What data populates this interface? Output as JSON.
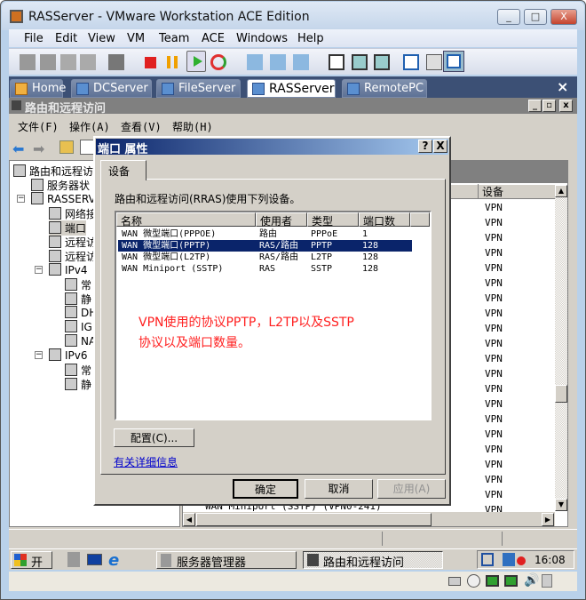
{
  "window": {
    "title": "RASServer - VMware Workstation ACE Edition",
    "min": "_",
    "max": "□",
    "close": "X"
  },
  "menu": [
    "File",
    "Edit",
    "View",
    "VM",
    "Team",
    "ACE",
    "Windows",
    "Help"
  ],
  "tabs": [
    {
      "label": "Home"
    },
    {
      "label": "DCServer"
    },
    {
      "label": "FileServer"
    },
    {
      "label": "RASServer",
      "active": true
    },
    {
      "label": "RemotePC"
    }
  ],
  "tabs_close": "×",
  "mmc": {
    "title": "路由和远程访问",
    "menu": [
      "文件(F)",
      "操作(A)",
      "查看(V)",
      "帮助(H)"
    ],
    "tree": [
      {
        "label": "路由和远程访",
        "level": 0
      },
      {
        "label": "服务器状",
        "level": 1
      },
      {
        "label": "RASSERVE",
        "level": 1,
        "expanded": true
      },
      {
        "label": "网络接",
        "level": 2
      },
      {
        "label": "端口",
        "level": 2
      },
      {
        "label": "远程访",
        "level": 2
      },
      {
        "label": "远程访",
        "level": 2
      },
      {
        "label": "IPv4",
        "level": 2,
        "expanded": true
      },
      {
        "label": "常",
        "level": 3
      },
      {
        "label": "静",
        "level": 3
      },
      {
        "label": "DH",
        "level": 3
      },
      {
        "label": "IG",
        "level": 3
      },
      {
        "label": "NA",
        "level": 3
      },
      {
        "label": "IPv6",
        "level": 2,
        "expanded": true
      },
      {
        "label": "常",
        "level": 3
      },
      {
        "label": "静",
        "level": 3
      }
    ],
    "right_column_header": "设备",
    "right_rows_value": "VPN",
    "right_row_count": 21,
    "right_last_row": "WAN Miniport (SSTP) (VPN0-241)"
  },
  "dialog": {
    "title": "端口 属性",
    "help": "?",
    "close": "X",
    "tab": "设备",
    "intro": "路由和远程访问(RRAS)使用下列设备。",
    "columns": [
      "名称",
      "使用者",
      "类型",
      "端口数"
    ],
    "rows": [
      [
        "WAN 微型端口(PPPOE)",
        "路由",
        "PPPoE",
        "1"
      ],
      [
        "WAN 微型端口(PPTP)",
        "RAS/路由",
        "PPTP",
        "128"
      ],
      [
        "WAN 微型端口(L2TP)",
        "RAS/路由",
        "L2TP",
        "128"
      ],
      [
        "WAN Miniport (SSTP)",
        "RAS",
        "SSTP",
        "128"
      ]
    ],
    "selected_row": 1,
    "annotation": [
      "VPN使用的协议PPTP，L2TP以及SSTP",
      "协议以及端口数量。"
    ],
    "configure": "配置(C)...",
    "more_info": "有关详细信息",
    "ok": "确定",
    "cancel": "取消",
    "apply": "应用(A)"
  },
  "taskbar": {
    "start": "开始",
    "items": [
      "服务器管理器",
      "路由和远程访问"
    ],
    "clock": "16:08"
  },
  "colors": {
    "dialog_title": "#0a246a",
    "annotation": "#ff2020",
    "tabbar": "#3c5075"
  }
}
